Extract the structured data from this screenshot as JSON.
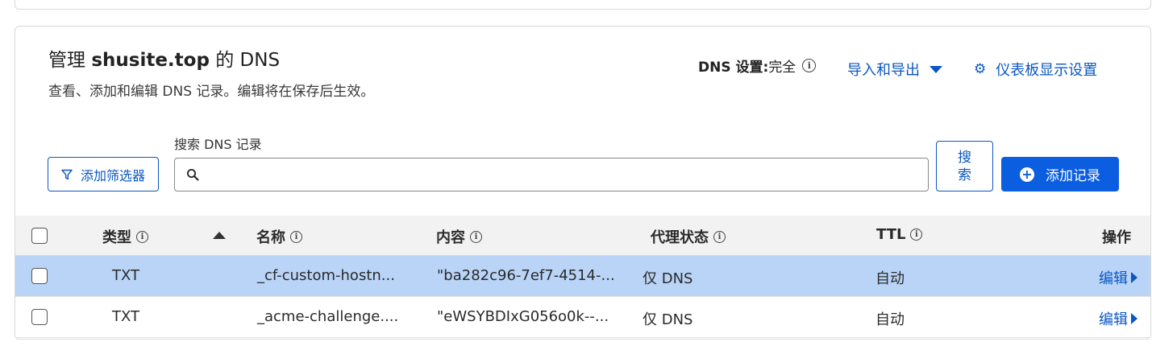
{
  "header": {
    "title_prefix": "管理",
    "title_domain": "shusite.top",
    "title_suffix": "的 DNS",
    "subtitle": "查看、添加和编辑 DNS 记录。编辑将在保存后生效。",
    "dns_settings_label": "DNS 设置:",
    "dns_settings_value": "完全",
    "import_export": "导入和导出",
    "dashboard_settings": "仪表板显示设置"
  },
  "toolbar": {
    "filter_button": "添加筛选器",
    "search_label": "搜索 DNS 记录",
    "search_value": "",
    "search_button": "搜索",
    "add_record_button": "添加记录"
  },
  "table": {
    "columns": {
      "type": "类型",
      "name": "名称",
      "content": "内容",
      "proxy": "代理状态",
      "ttl": "TTL",
      "actions": "操作"
    },
    "rows": [
      {
        "type": "TXT",
        "name": "_cf-custom-hostn...",
        "content": "\"ba282c96-7ef7-4514-...",
        "proxy": "仅 DNS",
        "ttl": "自动",
        "action": "编辑",
        "selected": true
      },
      {
        "type": "TXT",
        "name": "_acme-challenge....",
        "content": "\"eWSYBDIxG056o0k--...",
        "proxy": "仅 DNS",
        "ttl": "自动",
        "action": "编辑",
        "selected": false
      }
    ]
  },
  "colors": {
    "accent": "#0a57c2",
    "primary_button": "#0b5ee0",
    "selected_row": "#b9d4f7",
    "header_bg": "#f2f2f2"
  },
  "icons": {
    "info": "info-icon",
    "caret": "caret-down-icon",
    "gear": "gear-icon",
    "filter": "filter-icon",
    "search": "search-icon",
    "plus": "plus-circle-icon",
    "sort": "sort-asc-icon",
    "edit_arrow": "caret-right-icon"
  }
}
